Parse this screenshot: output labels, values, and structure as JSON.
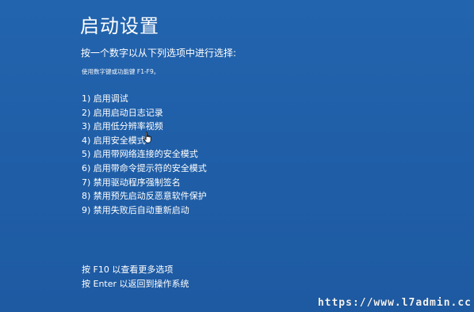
{
  "page": {
    "title": "启动设置",
    "subtitle": "按一个数字以从下列选项中进行选择:",
    "hint": "使用数字键或功能键 F1-F9。"
  },
  "options": [
    {
      "label": "1) 启用调试"
    },
    {
      "label": "2) 启用启动日志记录"
    },
    {
      "label": "3) 启用低分辨率视频"
    },
    {
      "label": "4) 启用安全模式"
    },
    {
      "label": "5) 启用带网络连接的安全模式"
    },
    {
      "label": "6) 启用带命令提示符的安全模式"
    },
    {
      "label": "7) 禁用驱动程序强制签名"
    },
    {
      "label": "8) 禁用预先启动反恶意软件保护"
    },
    {
      "label": "9) 禁用失败后自动重新启动"
    }
  ],
  "footer": {
    "more_options": "按 F10 以查看更多选项",
    "return": "按 Enter 以返回到操作系统"
  },
  "watermark": "https://www.l7admin.cc",
  "colors": {
    "background": "#1f5fa8",
    "text": "#ffffff"
  }
}
